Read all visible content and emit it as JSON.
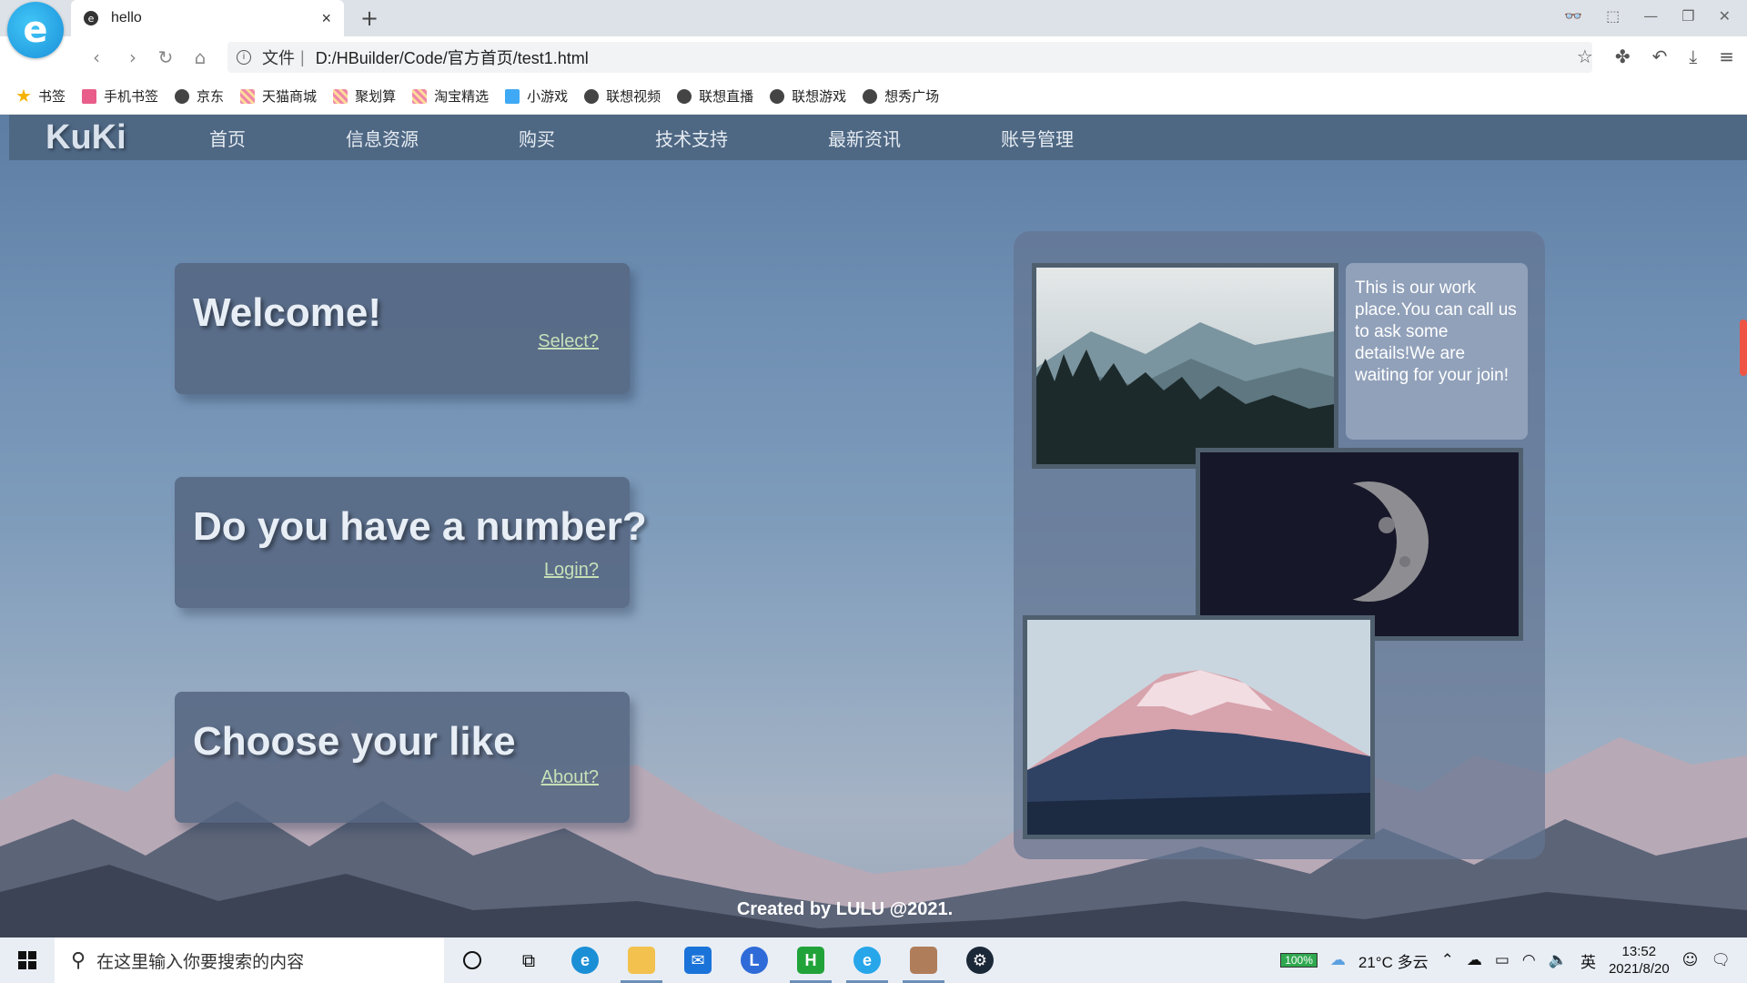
{
  "browser": {
    "tab_title": "hello",
    "tab_close": "×",
    "new_tab": "+",
    "url_file_label": "文件",
    "url_separator": "|",
    "url": "D:/HBuilder/Code/官方首页/test1.html",
    "bookmarks": [
      "书签",
      "手机书签",
      "京东",
      "天猫商城",
      "聚划算",
      "淘宝精选",
      "小游戏",
      "联想视频",
      "联想直播",
      "联想游戏",
      "想秀广场"
    ]
  },
  "site": {
    "logo": "KuKi",
    "menu": [
      "首页",
      "信息资源",
      "购买",
      "技术支持",
      "最新资讯",
      "账号管理"
    ],
    "cards": [
      {
        "title": "Welcome!",
        "link": "Select?"
      },
      {
        "title": "Do you have a number?",
        "link": "Login?"
      },
      {
        "title": "Choose your like",
        "link": "About?"
      }
    ],
    "info_text": "This is our work place.You can call us to ask some details!We are waiting for your join!",
    "footer": "Created by LULU @2021."
  },
  "taskbar": {
    "search_placeholder": "在这里输入你要搜索的内容",
    "battery": "100%",
    "weather": "21°C 多云",
    "ime": "英",
    "time": "13:52",
    "date": "2021/8/20"
  }
}
